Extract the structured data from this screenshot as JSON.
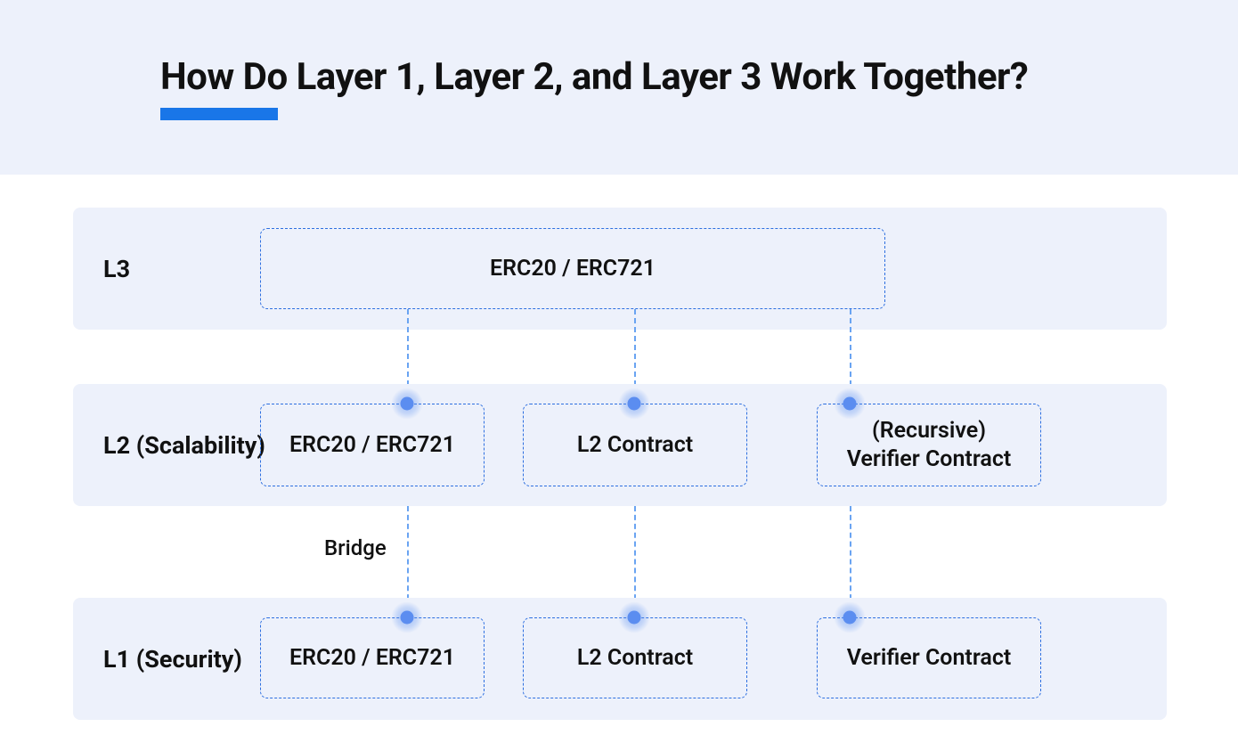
{
  "header": {
    "title": "How Do Layer 1, Layer 2, and Layer 3 Work Together?"
  },
  "rows": {
    "l3": {
      "label": "L3"
    },
    "l2": {
      "label": "L2 (Scalability)"
    },
    "l1": {
      "label": "L1 (Security)"
    }
  },
  "boxes": {
    "l3_main": "ERC20 / ERC721",
    "l2_a": "ERC20 / ERC721",
    "l2_b": "L2 Contract",
    "l2_c": "(Recursive)\nVerifier Contract",
    "l1_a": "ERC20 / ERC721",
    "l1_b": "L2 Contract",
    "l1_c": "Verifier Contract"
  },
  "labels": {
    "bridge": "Bridge"
  },
  "colors": {
    "band_bg": "#edf1fb",
    "underline": "#1976e8",
    "box_border": "#2d6fe0",
    "line": "#6aa4f2",
    "dot": "#5b8df0"
  }
}
